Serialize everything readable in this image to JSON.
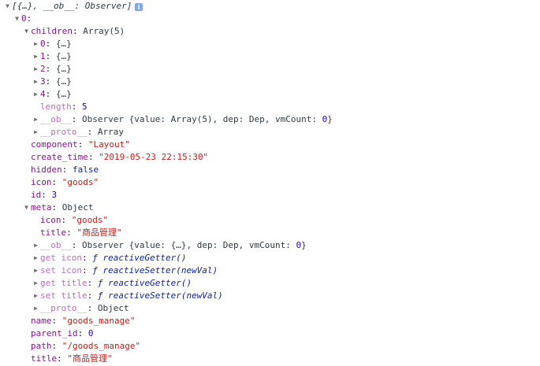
{
  "root": {
    "summary": "[{…}, __ob__: Observer]"
  },
  "item0": {
    "key": "0",
    "children": {
      "key": "children",
      "type": "Array(5)",
      "entries": [
        {
          "key": "0",
          "val": "{…}"
        },
        {
          "key": "1",
          "val": "{…}"
        },
        {
          "key": "2",
          "val": "{…}"
        },
        {
          "key": "3",
          "val": "{…}"
        },
        {
          "key": "4",
          "val": "{…}"
        }
      ],
      "length_key": "length",
      "length_val": "5",
      "ob_key": "__ob__",
      "ob_val_a": "Observer {value: Array(5), dep: Dep, vmCount: ",
      "ob_val_num": "0",
      "ob_val_b": "}",
      "proto_key": "__proto__",
      "proto_val": "Array"
    },
    "component": {
      "key": "component",
      "val": "\"Layout\""
    },
    "create_time": {
      "key": "create_time",
      "val": "\"2019-05-23 22:15:30\""
    },
    "hidden": {
      "key": "hidden",
      "val": "false"
    },
    "icon": {
      "key": "icon",
      "val": "\"goods\""
    },
    "id": {
      "key": "id",
      "val": "3"
    },
    "meta": {
      "key": "meta",
      "type": "Object",
      "icon_key": "icon",
      "icon_val": "\"goods\"",
      "title_key": "title",
      "title_val": "\"商品管理\"",
      "ob_key": "__ob__",
      "ob_val_a": "Observer {value: {…}, dep: Dep, vmCount: ",
      "ob_val_num": "0",
      "ob_val_b": "}",
      "get_icon_key": "get icon",
      "get_icon_val": "ƒ reactiveGetter()",
      "set_icon_key": "set icon",
      "set_icon_val": "ƒ reactiveSetter(newVal)",
      "get_title_key": "get title",
      "get_title_val": "ƒ reactiveGetter()",
      "set_title_key": "set title",
      "set_title_val": "ƒ reactiveSetter(newVal)",
      "proto_key": "__proto__",
      "proto_val": "Object"
    },
    "name": {
      "key": "name",
      "val": "\"goods_manage\""
    },
    "parent_id": {
      "key": "parent_id",
      "val": "0"
    },
    "path": {
      "key": "path",
      "val": "\"/goods_manage\""
    },
    "title": {
      "key": "title",
      "val": "\"商品管理\""
    }
  },
  "icons": {
    "expanded": "triangle-down-icon",
    "collapsed": "triangle-right-icon",
    "info": "info-icon"
  },
  "colors": {
    "key": "#881391",
    "string": "#c41a16",
    "number": "#1c00cf",
    "keyword": "#0d22aa",
    "info": "#7fa7e6"
  }
}
